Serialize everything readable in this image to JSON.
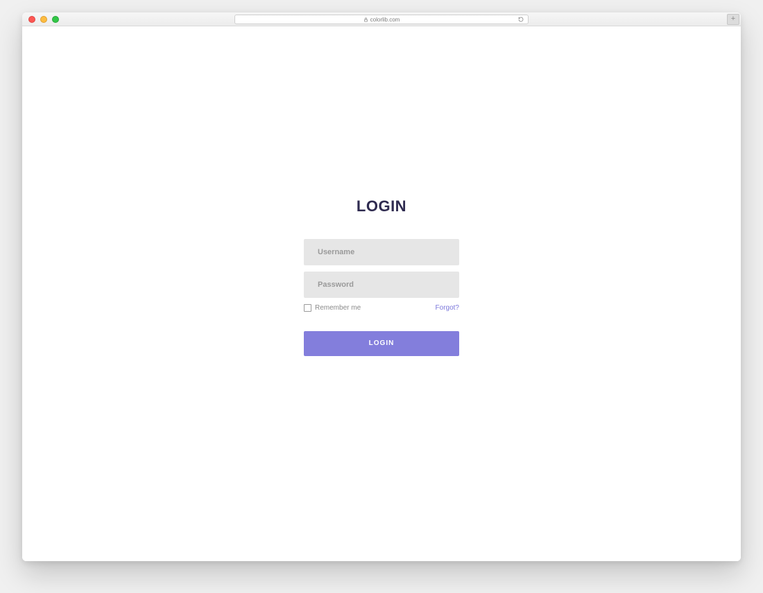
{
  "browser": {
    "url_display": "colorlib.com"
  },
  "login": {
    "title": "LOGIN",
    "username_placeholder": "Username",
    "password_placeholder": "Password",
    "remember_label": "Remember me",
    "forgot_label": "Forgot?",
    "submit_label": "LOGIN"
  }
}
